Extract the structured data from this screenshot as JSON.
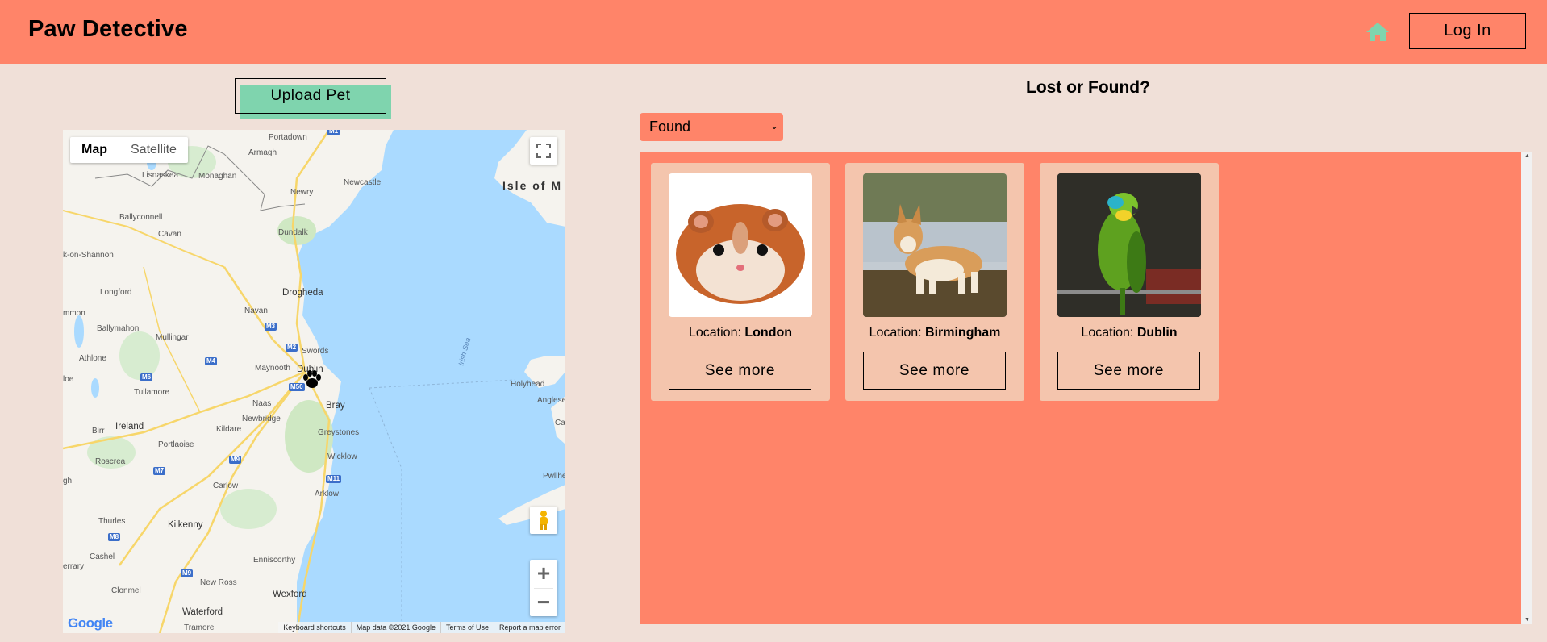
{
  "header": {
    "brand": "Paw Detective",
    "home_icon": "home-icon",
    "login_label": "Log In",
    "accent": "#7fd4ae",
    "background": "#ff8469"
  },
  "upload": {
    "label": "Upload Pet"
  },
  "map": {
    "type_options": [
      "Map",
      "Satellite"
    ],
    "selected_type": "Map",
    "marker_icon": "paw-icon",
    "logo": "Google",
    "footer": [
      "Keyboard shortcuts",
      "Map data ©2021 Google",
      "Terms of Use",
      "Report a map error"
    ],
    "labels": {
      "portadown": "Portadown",
      "armagh": "Armagh",
      "lisnaskea": "Lisnaskea",
      "monaghan": "Monaghan",
      "newry": "Newry",
      "newcastle": "Newcastle",
      "isle_of_man": "Isle of M",
      "ballyconnell": "Ballyconnell",
      "cavan": "Cavan",
      "dundalk": "Dundalk",
      "carrick": "k-on-Shannon",
      "longford": "Longford",
      "drogheda": "Drogheda",
      "navan": "Navan",
      "mmon": "mmon",
      "ballymahon": "Ballymahon",
      "mullingar": "Mullingar",
      "swords": "Swords",
      "athlone": "Athlone",
      "maynooth": "Maynooth",
      "dublin": "Dublin",
      "irish_sea": "Irish Sea",
      "holyhead": "Holyhead",
      "anglesey": "Anglese",
      "loe": "loe",
      "tullamore": "Tullamore",
      "naas": "Naas",
      "bray": "Bray",
      "newbridge": "Newbridge",
      "birr": "Birr",
      "ireland": "Ireland",
      "kildare": "Kildare",
      "greystones": "Greystones",
      "portlaoise": "Portlaoise",
      "wicklow": "Wicklow",
      "cae": "Cae",
      "roscrea": "Roscrea",
      "carlow": "Carlow",
      "arklow": "Arklow",
      "pwllhe": "Pwllhe",
      "thurles": "Thurles",
      "kilkenny": "Kilkenny",
      "gh": "gh",
      "cashel": "Cashel",
      "enniscorthy": "Enniscorthy",
      "errary": "errary",
      "new_ross": "New Ross",
      "clonmel": "Clonmel",
      "wexford": "Wexford",
      "waterford": "Waterford",
      "tramore": "Tramore"
    },
    "shields": [
      "M1",
      "M3",
      "M2",
      "M4",
      "M6",
      "M50",
      "M9",
      "M7",
      "M11",
      "M8",
      "M9"
    ]
  },
  "filter": {
    "title": "Lost or Found?",
    "selected": "Found",
    "chevron": "chevron-down-icon"
  },
  "pets": [
    {
      "label": "Location: ",
      "location": "London",
      "button": "See more",
      "animal": "hamster"
    },
    {
      "label": "Location: ",
      "location": "Birmingham",
      "button": "See more",
      "animal": "corgi"
    },
    {
      "label": "Location: ",
      "location": "Dublin",
      "button": "See more",
      "animal": "parrot"
    }
  ]
}
